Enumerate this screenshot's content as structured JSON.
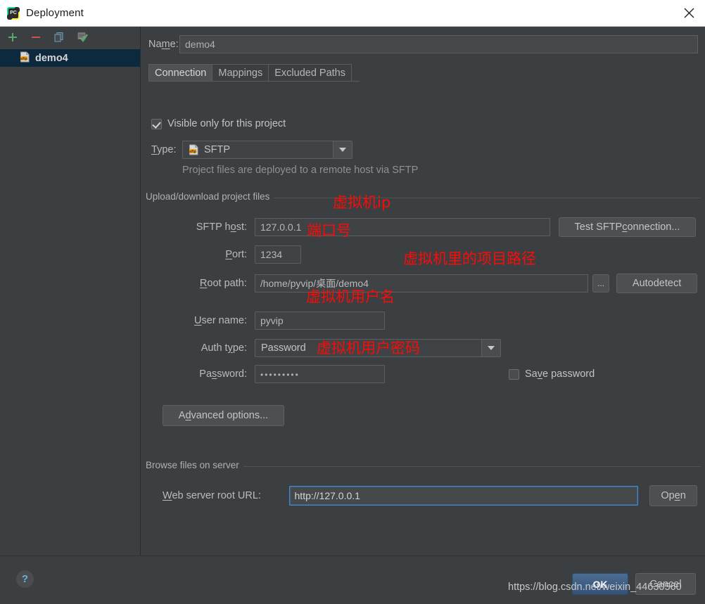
{
  "window": {
    "title": "Deployment",
    "icon": "pycharm-icon",
    "close_label": "×"
  },
  "sidebar": {
    "toolbar": [
      {
        "name": "add-button",
        "glyph": "+"
      },
      {
        "name": "remove-button",
        "glyph": "−"
      },
      {
        "name": "copy-button",
        "glyph": "copy"
      },
      {
        "name": "set-default-button",
        "glyph": "check"
      }
    ],
    "items": [
      {
        "label": "demo4",
        "icon": "sftp-icon",
        "selected": true
      }
    ]
  },
  "form": {
    "name_label": "Name:",
    "name_value": "demo4"
  },
  "tabs": [
    {
      "label": "Connection",
      "active": true
    },
    {
      "label": "Mappings",
      "active": false
    },
    {
      "label": "Excluded Paths",
      "active": false
    }
  ],
  "connection": {
    "visible_only_label": "Visible only for this project",
    "visible_only_checked": true,
    "type_label": "Type:",
    "type_value": "SFTP",
    "type_hint": "Project files are deployed to a remote host via SFTP",
    "upload_group_title": "Upload/download project files",
    "sftp_host_label": "SFTP host:",
    "sftp_host_value": "127.0.0.1",
    "test_connection_label": "Test SFTP connection...",
    "port_label": "Port:",
    "port_value": "1234",
    "root_path_label": "Root path:",
    "root_path_value": "/home/pyvip/桌面/demo4",
    "browse_label": "...",
    "autodetect_label": "Autodetect",
    "user_name_label": "User name:",
    "user_name_value": "pyvip",
    "auth_type_label": "Auth type:",
    "auth_type_value": "Password",
    "password_label": "Password:",
    "password_value": "•••••••••",
    "save_password_label": "Save password",
    "save_password_checked": false,
    "advanced_options_label": "Advanced options...",
    "browse_group_title": "Browse files on server",
    "web_server_url_label": "Web server root URL:",
    "web_server_url_value": "http://127.0.0.1",
    "open_label": "Open"
  },
  "annotations": [
    {
      "text": "虚拟机ip",
      "meaning": "sftp-host-annotation"
    },
    {
      "text": "端口号",
      "meaning": "port-annotation"
    },
    {
      "text": "虚拟机里的项目路径",
      "meaning": "root-path-annotation"
    },
    {
      "text": "虚拟机用户名",
      "meaning": "user-name-annotation"
    },
    {
      "text": "虚拟机用户密码",
      "meaning": "password-annotation"
    }
  ],
  "footer": {
    "help_label": "?",
    "ok_label": "OK",
    "cancel_label": "Cancel",
    "watermark": "https://blog.csdn.net/weixin_44630560"
  },
  "colors": {
    "background": "#3c3f41",
    "selection": "#0d293e",
    "annotation": "#fb0b08",
    "accent_ok": "#3d5e85",
    "focus_border": "#4a88c7"
  }
}
